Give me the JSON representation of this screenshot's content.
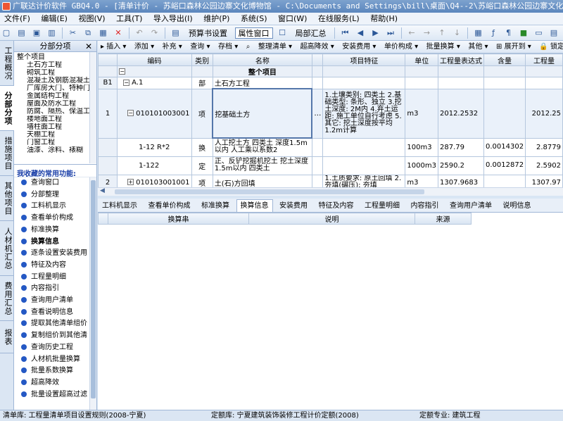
{
  "window": {
    "title": "广联达计价软件 GBQ4.0 - [清单计价 - 苏峪口森林公园边寨文化博物馆 - C:\\Documents and Settings\\bill\\桌面\\Q4--2\\苏峪口森林公园边寨文化博物馆"
  },
  "menu": [
    "文件(F)",
    "编辑(E)",
    "视图(V)",
    "工具(T)",
    "导入导出(I)",
    "维护(P)",
    "系统(S)",
    "窗口(W)",
    "在线服务(L)",
    "帮助(H)"
  ],
  "toolbar": {
    "budget_settings": "预算书设置",
    "property_window": "属性窗口",
    "local_summary": "局部汇总"
  },
  "vtabs": [
    "工程概况",
    "分部分项",
    "措施项目",
    "其他项目",
    "人材机汇总",
    "费用汇总",
    "报表"
  ],
  "left_panel": {
    "header": "分部分项",
    "close": "✕",
    "tree_root": "整个项目",
    "tree_items": [
      "土石方工程",
      "砌筑工程",
      "混凝土及钢筋混凝土",
      "厂库房大门、特种门",
      "金属结构工程",
      "屋面及防水工程",
      "防腐、隔热、保温工",
      "楼地面工程",
      "墙柱面工程",
      "天棚工程",
      "门窗工程",
      "油漆、涂料、裱糊"
    ],
    "favorites_title": "我收藏的常用功能:",
    "favorites": [
      "查询窗口",
      "分部整理",
      "工料机显示",
      "查看单价构成",
      "标准换算",
      "换算信息",
      "逐条设置安装费用",
      "特征及内容",
      "工程量明细",
      "内容指引",
      "查询用户清单",
      "查看说明信息",
      "提取其他清单组价",
      "复制组价到其他清",
      "查询历史工程",
      "人材机批量换算",
      "批量系数换算",
      "超高降效",
      "批量设置超高过滤"
    ]
  },
  "subtoolbar": [
    "插入",
    "添加",
    "补充",
    "查询",
    "存档",
    "整理清单",
    "超高降效",
    "安装费用",
    "单价构成",
    "批量换算",
    "其他",
    "展开到",
    "锁定清单"
  ],
  "grid": {
    "headers": [
      "",
      "编码",
      "类别",
      "名称",
      "",
      "项目特征",
      "单位",
      "工程量表达式",
      "含量",
      "工程量"
    ],
    "whole_project": "整个项目",
    "rows": [
      {
        "num": "B1",
        "code": "A.1",
        "type": "部",
        "name": "土石方工程",
        "feature": "",
        "unit": "",
        "expr": "",
        "content": "",
        "qty": ""
      },
      {
        "num": "1",
        "code": "010101003001",
        "type": "项",
        "name": "挖基础土方",
        "feature": "1.土壤类别: 四类土 2.基础类型: 条形、独立 3.挖土深度: 2M内 4.弃土运距: 施工单位自行考虑 5.其它: 挖土深度按平均1.2m计算",
        "unit": "m3",
        "expr": "2012.2532",
        "content": "",
        "qty": "2012.25"
      },
      {
        "num": "",
        "code": "1-12 R*2",
        "type": "换",
        "name": "人工挖土方 四类土 深度1.5m以内 人工乘以系数2",
        "feature": "",
        "unit": "100m3",
        "expr": "287.79",
        "content": "0.0014302",
        "qty": "2.8779"
      },
      {
        "num": "",
        "code": "1-122",
        "type": "定",
        "name": "正、反铲挖掘机挖土 挖土深度1.5m以内 四类土",
        "feature": "",
        "unit": "1000m3",
        "expr": "2590.2",
        "content": "0.0012872",
        "qty": "2.5902"
      },
      {
        "num": "2",
        "code": "010103001001",
        "type": "项",
        "name": "土(石)方回填",
        "feature": "1.土质要求: 原土回填 2.夯填(碾压): 夯填",
        "unit": "m3",
        "expr": "1307.9683",
        "content": "",
        "qty": "1307.97"
      }
    ]
  },
  "bottom_tabs": [
    "工料机显示",
    "查看单价构成",
    "标准换算",
    "换算信息",
    "安装费用",
    "特征及内容",
    "工程量明细",
    "内容指引",
    "查询用户清单",
    "说明信息"
  ],
  "detail_headers": [
    "",
    "换算串",
    "说明",
    "来源"
  ],
  "statusbar": {
    "list_lib": "清单库: 工程量清单项目设置规则(2008-宁夏)",
    "quota_lib": "定额库: 宁夏建筑装饰装修工程计价定额(2008)",
    "quota_major": "定额专业: 建筑工程"
  }
}
